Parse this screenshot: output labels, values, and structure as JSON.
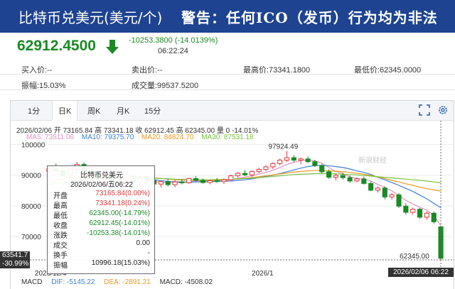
{
  "header": {
    "title": "比特币兑美元(美元/个)",
    "warning": "警告：任何ICO（发币）行为均为非法"
  },
  "quote": {
    "price": "62912.4500",
    "change": "-10253.3800 (-14.0139%)",
    "time": "06:22:24",
    "direction_icon": "arrow-down-icon",
    "down_color": "#1a8a24"
  },
  "stats": {
    "buy": "买入价:--",
    "sell": "卖出价:--",
    "high": "最高价:73341.1800",
    "low": "最低价:62345.0000",
    "amplitude": "振幅:15.03%",
    "volume": "成交量:99537.5200"
  },
  "tabs": [
    "1分",
    "日K",
    "周K",
    "月K",
    "15分"
  ],
  "active_tab": "日K",
  "tools": [
    "expand-icon",
    "settings-icon"
  ],
  "ohlc_line": "2026/02/06 开 73165.84 高 73341.18 收 62912.45 高 62345.00 量 0 -14.01%",
  "ma": {
    "ma5": "MA5: 73511.06",
    "ma10": "MA10: 79375.70",
    "ma20": "MA20: 84824.70",
    "ma30": "MA30: 87531.18",
    "colors": {
      "ma5": "#e391c4",
      "ma10": "#3f7fd6",
      "ma20": "#e89b23",
      "ma30": "#7ac143"
    }
  },
  "chart_data": {
    "type": "candlestick",
    "y_ticks": [
      "100000",
      "90000",
      "80000",
      "70000"
    ],
    "ylim": [
      61000,
      101500
    ],
    "x_ticks": [
      "2025/12/4",
      "2026/1"
    ],
    "peak_label": "97924.49",
    "last_label": "62345.00",
    "up_color": "#e0393e",
    "down_color": "#1a8a24",
    "candles": [
      {
        "o": 91200,
        "h": 92900,
        "l": 90600,
        "c": 92100
      },
      {
        "o": 92100,
        "h": 93800,
        "l": 91000,
        "c": 91500
      },
      {
        "o": 91500,
        "h": 92600,
        "l": 89400,
        "c": 89900
      },
      {
        "o": 89900,
        "h": 92500,
        "l": 89300,
        "c": 92000
      },
      {
        "o": 92000,
        "h": 94300,
        "l": 91500,
        "c": 93500
      },
      {
        "o": 93500,
        "h": 94200,
        "l": 90800,
        "c": 91300
      },
      {
        "o": 91300,
        "h": 92600,
        "l": 90100,
        "c": 90700
      },
      {
        "o": 90700,
        "h": 91400,
        "l": 88100,
        "c": 88700
      },
      {
        "o": 88700,
        "h": 90300,
        "l": 87600,
        "c": 89900
      },
      {
        "o": 89900,
        "h": 90900,
        "l": 87800,
        "c": 88300
      },
      {
        "o": 88300,
        "h": 89800,
        "l": 86900,
        "c": 87400
      },
      {
        "o": 87400,
        "h": 88700,
        "l": 86200,
        "c": 88200
      },
      {
        "o": 88200,
        "h": 89600,
        "l": 87300,
        "c": 87700
      },
      {
        "o": 87700,
        "h": 89100,
        "l": 86500,
        "c": 88900
      },
      {
        "o": 88900,
        "h": 89900,
        "l": 87900,
        "c": 88400
      },
      {
        "o": 88400,
        "h": 89200,
        "l": 86800,
        "c": 87100
      },
      {
        "o": 87100,
        "h": 88300,
        "l": 86000,
        "c": 87900
      },
      {
        "o": 87900,
        "h": 88800,
        "l": 86400,
        "c": 86900
      },
      {
        "o": 86900,
        "h": 88400,
        "l": 86100,
        "c": 87800
      },
      {
        "o": 87800,
        "h": 88700,
        "l": 87000,
        "c": 87500
      },
      {
        "o": 87500,
        "h": 89200,
        "l": 87200,
        "c": 88900
      },
      {
        "o": 88900,
        "h": 89700,
        "l": 87900,
        "c": 88300
      },
      {
        "o": 88300,
        "h": 88900,
        "l": 87200,
        "c": 87600
      },
      {
        "o": 87600,
        "h": 88600,
        "l": 87000,
        "c": 88200
      },
      {
        "o": 88200,
        "h": 89100,
        "l": 87500,
        "c": 87900
      },
      {
        "o": 87900,
        "h": 88900,
        "l": 87100,
        "c": 88500
      },
      {
        "o": 88500,
        "h": 90200,
        "l": 88000,
        "c": 89800
      },
      {
        "o": 89800,
        "h": 91100,
        "l": 89200,
        "c": 90600
      },
      {
        "o": 90600,
        "h": 91700,
        "l": 89700,
        "c": 90100
      },
      {
        "o": 90100,
        "h": 91600,
        "l": 89400,
        "c": 91200
      },
      {
        "o": 91200,
        "h": 92400,
        "l": 90600,
        "c": 91900
      },
      {
        "o": 91900,
        "h": 93200,
        "l": 91300,
        "c": 92700
      },
      {
        "o": 92700,
        "h": 94200,
        "l": 92000,
        "c": 93800
      },
      {
        "o": 93800,
        "h": 95400,
        "l": 93200,
        "c": 94900
      },
      {
        "o": 94900,
        "h": 97924.49,
        "l": 94300,
        "c": 95700
      },
      {
        "o": 95700,
        "h": 96500,
        "l": 94200,
        "c": 94900
      },
      {
        "o": 94900,
        "h": 95800,
        "l": 93600,
        "c": 95300
      },
      {
        "o": 95300,
        "h": 96100,
        "l": 93900,
        "c": 94400
      },
      {
        "o": 94400,
        "h": 95000,
        "l": 92700,
        "c": 93100
      },
      {
        "o": 93100,
        "h": 93700,
        "l": 90400,
        "c": 91100
      },
      {
        "o": 91100,
        "h": 91900,
        "l": 88800,
        "c": 89300
      },
      {
        "o": 89300,
        "h": 90600,
        "l": 88300,
        "c": 89900
      },
      {
        "o": 89900,
        "h": 90800,
        "l": 88600,
        "c": 89200
      },
      {
        "o": 89200,
        "h": 89900,
        "l": 87500,
        "c": 88100
      },
      {
        "o": 88100,
        "h": 89300,
        "l": 87700,
        "c": 88800
      },
      {
        "o": 88800,
        "h": 89600,
        "l": 86900,
        "c": 87300
      },
      {
        "o": 87300,
        "h": 87900,
        "l": 84800,
        "c": 85100
      },
      {
        "o": 85100,
        "h": 86300,
        "l": 84300,
        "c": 85800
      },
      {
        "o": 85800,
        "h": 86400,
        "l": 82100,
        "c": 82900
      },
      {
        "o": 82900,
        "h": 84200,
        "l": 82000,
        "c": 83600
      },
      {
        "o": 83600,
        "h": 84100,
        "l": 79300,
        "c": 79900
      },
      {
        "o": 79900,
        "h": 80800,
        "l": 77200,
        "c": 77900
      },
      {
        "o": 77900,
        "h": 79400,
        "l": 77100,
        "c": 78900
      },
      {
        "o": 78900,
        "h": 79300,
        "l": 75800,
        "c": 76300
      },
      {
        "o": 76300,
        "h": 78200,
        "l": 75500,
        "c": 77600
      },
      {
        "o": 77600,
        "h": 78100,
        "l": 74200,
        "c": 74800
      },
      {
        "o": 73165.84,
        "h": 73341.18,
        "l": 62345.0,
        "c": 62912.45
      }
    ],
    "ma_series": [
      {
        "name": "MA5",
        "values": [
          90800,
          91400,
          91200,
          91300,
          91800,
          91600,
          91400,
          90900,
          90600,
          89900,
          89100,
          88500,
          88300,
          87900,
          88000,
          88000,
          87600,
          87600,
          87600,
          87600,
          87800,
          88100,
          88000,
          88100,
          88200,
          88200,
          88500,
          89000,
          89400,
          89800,
          90400,
          90900,
          91600,
          92500,
          93500,
          94200,
          94800,
          95000,
          94700,
          93900,
          92500,
          91200,
          90500,
          89500,
          88900,
          88700,
          88100,
          87000,
          86000,
          84900,
          83400,
          81800,
          80600,
          79500,
          78600,
          76900,
          73511.06
        ]
      },
      {
        "name": "MA10",
        "values": [
          89600,
          90000,
          90300,
          90600,
          91000,
          91100,
          91200,
          91100,
          91000,
          90700,
          90400,
          90100,
          89700,
          89300,
          88900,
          88500,
          88200,
          88000,
          87900,
          87800,
          87700,
          87800,
          87800,
          87900,
          88000,
          88000,
          88100,
          88300,
          88500,
          88800,
          89200,
          89600,
          90000,
          90500,
          91100,
          91700,
          92300,
          92800,
          93100,
          93200,
          93100,
          92800,
          92500,
          92000,
          91400,
          90900,
          90200,
          89300,
          88500,
          87600,
          86700,
          85700,
          84700,
          83500,
          82300,
          80800,
          79375.7
        ]
      },
      {
        "name": "MA20",
        "values": [
          88000,
          88400,
          88800,
          89100,
          89400,
          89700,
          89900,
          90000,
          90100,
          90100,
          90100,
          90000,
          89800,
          89600,
          89400,
          89100,
          88900,
          88700,
          88500,
          88400,
          88300,
          88300,
          88300,
          88300,
          88400,
          88500,
          88600,
          88800,
          89000,
          89200,
          89500,
          89800,
          90100,
          90400,
          90700,
          91000,
          91200,
          91400,
          91500,
          91500,
          91400,
          91300,
          91100,
          90900,
          90600,
          90300,
          89900,
          89400,
          88900,
          88300,
          87800,
          87200,
          86700,
          86100,
          85600,
          85200,
          84824.7
        ]
      },
      {
        "name": "MA30",
        "values": [
          87000,
          87300,
          87600,
          87900,
          88200,
          88500,
          88700,
          88900,
          89000,
          89100,
          89200,
          89200,
          89200,
          89200,
          89100,
          89000,
          88900,
          88800,
          88700,
          88600,
          88600,
          88500,
          88500,
          88500,
          88600,
          88600,
          88700,
          88800,
          88900,
          89000,
          89200,
          89400,
          89600,
          89800,
          90000,
          90200,
          90300,
          90400,
          90500,
          90500,
          90500,
          90400,
          90300,
          90200,
          90100,
          89900,
          89700,
          89500,
          89300,
          89100,
          88900,
          88700,
          88500,
          88300,
          88100,
          87800,
          87531.18
        ]
      }
    ]
  },
  "tooltip": {
    "title": "比特币兑美元",
    "date": "2026/02/06/五06:22",
    "rows": [
      {
        "k": "开盘",
        "v": "73165.84(0.00%)",
        "color": "#e0393e"
      },
      {
        "k": "最高",
        "v": "73341.18(0.24%)",
        "color": "#e0393e"
      },
      {
        "k": "最低",
        "v": "62345.00(-14.79%)",
        "color": "#1a8a24"
      },
      {
        "k": "收盘",
        "v": "62912.45(-14.01%)",
        "color": "#1a8a24"
      },
      {
        "k": "涨跌",
        "v": "-10253.38(-14.01%)",
        "color": "#1a8a24"
      },
      {
        "k": "成交",
        "v": "0.00",
        "color": "#222222"
      },
      {
        "k": "换手",
        "v": "-",
        "color": "#222222"
      },
      {
        "k": "振幅",
        "v": "10996.18(15.03%)",
        "color": "#222222"
      }
    ]
  },
  "crosshair": {
    "price": "63541.7",
    "pct": "-30.99%",
    "date": "2026/02/06 06:22"
  },
  "macd": {
    "label": "MACD",
    "dif": "DIF: -5145.22",
    "dea": "DEA: -2891.21",
    "macd": "MACD: -4508.02"
  },
  "watermark": "新浪财经"
}
